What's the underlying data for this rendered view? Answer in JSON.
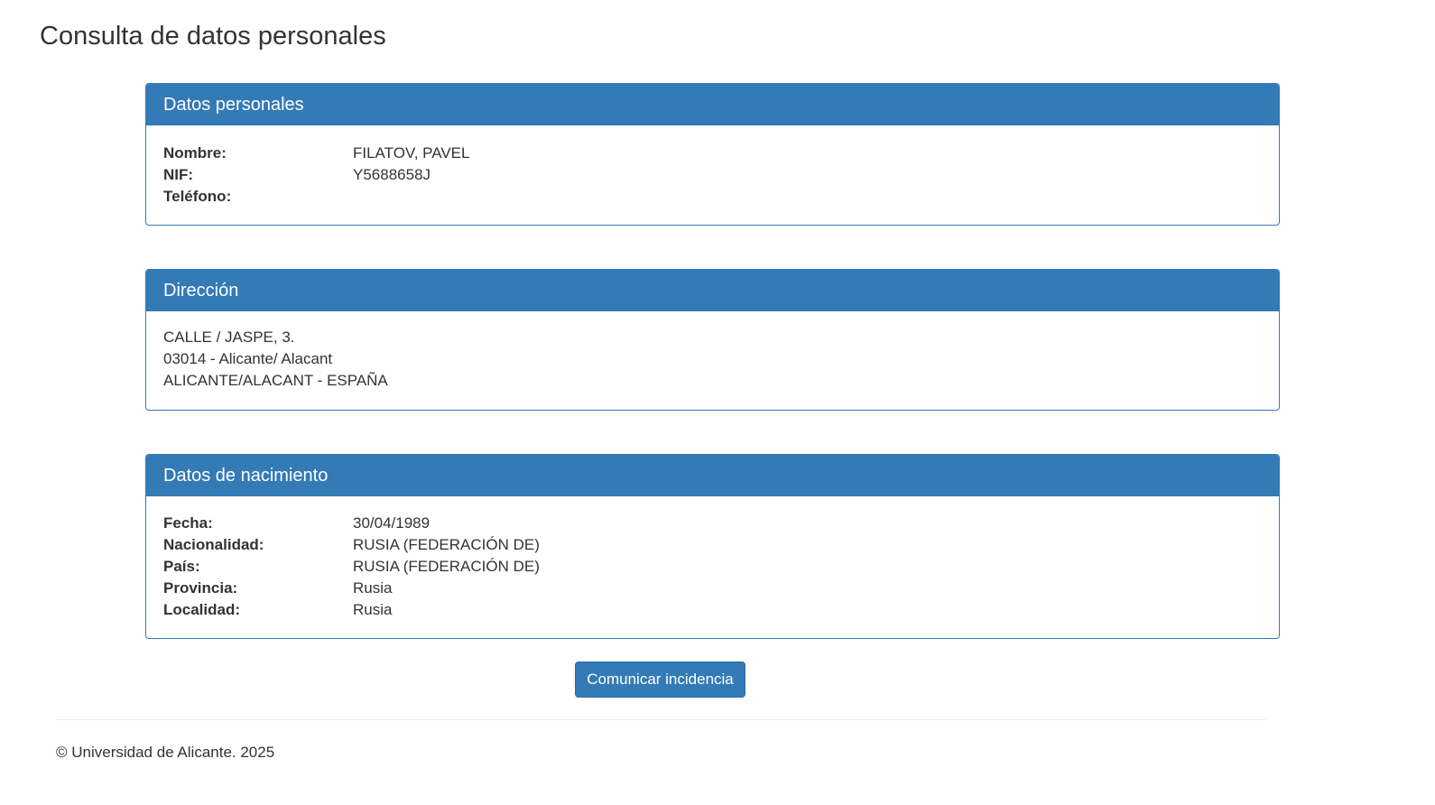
{
  "page": {
    "title": "Consulta de datos personales"
  },
  "personal": {
    "heading": "Datos personales",
    "rows": [
      {
        "label": "Nombre:",
        "value": "FILATOV, PAVEL"
      },
      {
        "label": "NIF:",
        "value": "Y5688658J"
      },
      {
        "label": "Teléfono:",
        "value": ""
      }
    ]
  },
  "address": {
    "heading": "Dirección",
    "lines": [
      "CALLE / JASPE, 3.",
      "03014 - Alicante/ Alacant",
      "ALICANTE/ALACANT - ESPAÑA"
    ]
  },
  "birth": {
    "heading": "Datos de nacimiento",
    "rows": [
      {
        "label": "Fecha:",
        "value": "30/04/1989"
      },
      {
        "label": "Nacionalidad:",
        "value": "RUSIA (FEDERACIÓN DE)"
      },
      {
        "label": "País:",
        "value": "RUSIA (FEDERACIÓN DE)"
      },
      {
        "label": "Provincia:",
        "value": "Rusia"
      },
      {
        "label": "Localidad:",
        "value": "Rusia"
      }
    ]
  },
  "actions": {
    "report_label": "Comunicar incidencia"
  },
  "footer": {
    "copyright": "© Universidad de Alicante. 2025"
  },
  "colors": {
    "primary": "#337ab7",
    "text": "#333333",
    "divider": "#eeeeee"
  }
}
